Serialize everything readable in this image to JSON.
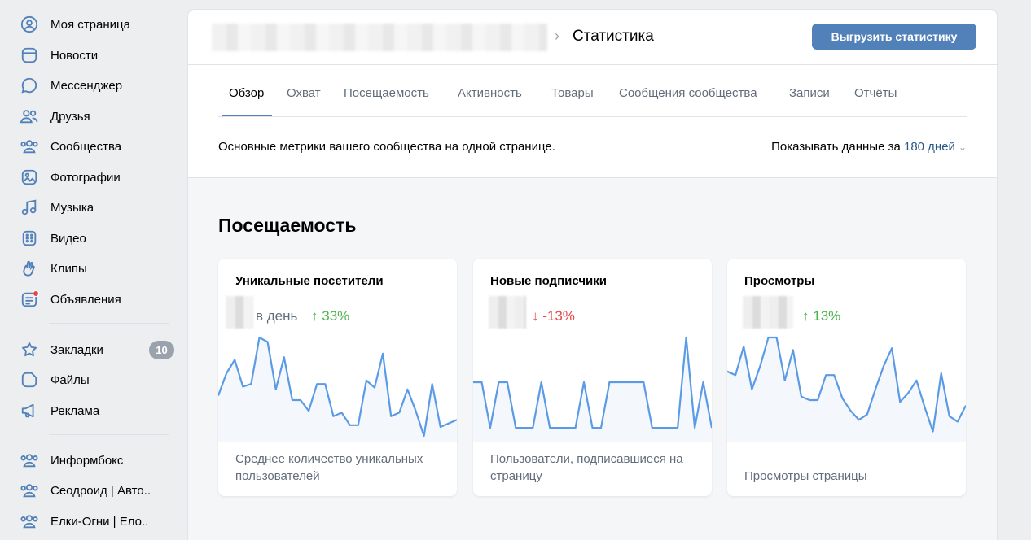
{
  "sidebar": {
    "items": [
      {
        "label": "Моя страница",
        "icon": "user-circle-icon"
      },
      {
        "label": "Новости",
        "icon": "news-icon"
      },
      {
        "label": "Мессенджер",
        "icon": "message-icon"
      },
      {
        "label": "Друзья",
        "icon": "friends-icon"
      },
      {
        "label": "Сообщества",
        "icon": "communities-icon"
      },
      {
        "label": "Фотографии",
        "icon": "photo-icon"
      },
      {
        "label": "Музыка",
        "icon": "music-icon"
      },
      {
        "label": "Видео",
        "icon": "video-icon"
      },
      {
        "label": "Клипы",
        "icon": "clips-icon"
      },
      {
        "label": "Объявления",
        "icon": "classifieds-icon"
      }
    ],
    "items2": [
      {
        "label": "Закладки",
        "icon": "star-icon",
        "badge": "10"
      },
      {
        "label": "Файлы",
        "icon": "file-icon"
      },
      {
        "label": "Реклама",
        "icon": "megaphone-icon"
      }
    ],
    "groups": [
      {
        "label": "Информбокс",
        "icon": "group-icon"
      },
      {
        "label": "Сеодроид | Авто..",
        "icon": "group-icon"
      },
      {
        "label": "Елки-Огни | Ело..",
        "icon": "group-icon"
      }
    ]
  },
  "header": {
    "title": "Статистика",
    "export_label": "Выгрузить статистику"
  },
  "tabs": [
    "Обзор",
    "Охват",
    "Посещаемость",
    "Активность",
    "Товары",
    "Сообщения сообщества",
    "Записи",
    "Отчёты"
  ],
  "subrow": {
    "description": "Основные метрики вашего сообщества на одной странице.",
    "period_label": "Показывать данные за",
    "period_value": "180 дней"
  },
  "section": {
    "title": "Посещаемость"
  },
  "cards": [
    {
      "title": "Уникальные посетители",
      "suffix": "в день",
      "delta": "33%",
      "delta_dir": "up",
      "description": "Среднее количество уникальных пользователей",
      "series": [
        0.35,
        0.6,
        0.75,
        0.45,
        0.48,
        1.0,
        0.95,
        0.42,
        0.78,
        0.3,
        0.3,
        0.18,
        0.48,
        0.48,
        0.12,
        0.16,
        0.02,
        0.02,
        0.52,
        0.44,
        0.82,
        0.12,
        0.16,
        0.42,
        0.18,
        -0.1,
        0.48,
        0.0,
        0.04,
        0.08
      ]
    },
    {
      "title": "Новые подписчики",
      "suffix": "",
      "delta": "-13%",
      "delta_dir": "down",
      "description": "Пользователи, подписавшиеся на страницу",
      "series": [
        0.5,
        0.5,
        -0.01,
        0.5,
        0.5,
        -0.01,
        -0.01,
        -0.01,
        0.5,
        -0.01,
        -0.01,
        -0.01,
        -0.01,
        0.5,
        -0.01,
        -0.01,
        0.5,
        0.5,
        0.5,
        0.5,
        0.5,
        -0.01,
        -0.01,
        -0.01,
        -0.01,
        1.0,
        -0.01,
        0.5,
        -0.01
      ]
    },
    {
      "title": "Просмотры",
      "suffix": "",
      "delta": "13%",
      "delta_dir": "up",
      "description": "Просмотры страницы",
      "series": [
        0.62,
        0.58,
        0.9,
        0.42,
        0.68,
        1.0,
        1.0,
        0.52,
        0.86,
        0.34,
        0.3,
        0.3,
        0.58,
        0.58,
        0.32,
        0.18,
        0.08,
        0.14,
        0.42,
        0.68,
        0.88,
        0.28,
        0.38,
        0.52,
        0.22,
        -0.05,
        0.6,
        0.12,
        0.06,
        0.24
      ]
    }
  ],
  "colors": {
    "accent": "#5181b8",
    "link": "#2a5885",
    "spark_line": "#5b9be6",
    "positive": "#4bb34b",
    "negative": "#e64646",
    "badge": "#99a2ad"
  }
}
